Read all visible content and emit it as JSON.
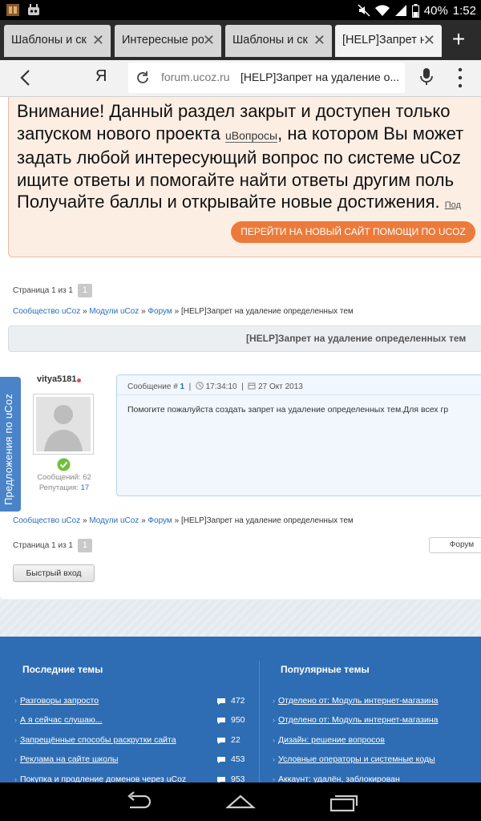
{
  "status_bar": {
    "battery_percent": "40%",
    "time": "1:52",
    "icons": [
      "app-icon",
      "robot-icon",
      "mute-icon",
      "wifi-icon",
      "signal-icon",
      "battery-icon"
    ]
  },
  "tabs": [
    {
      "label": "Шаблоны и ск",
      "active": false
    },
    {
      "label": "Интересные ро",
      "active": false
    },
    {
      "label": "Шаблоны и ск",
      "active": false
    },
    {
      "label": "[HELP]Запрет н",
      "active": true
    }
  ],
  "address_bar": {
    "yandex_label": "Я",
    "host": "forum.ucoz.ru",
    "page_title": "[HELP]Запрет на удаление о..."
  },
  "notice": {
    "line1": "Внимание! Данный раздел закрыт и доступен только",
    "line2_before": "запуском нового проекта ",
    "line2_link": "uВопросы",
    "line2_after": ", на котором Вы может",
    "line3": "задать любой интересующий вопрос по системе uCoz",
    "line4": "ищите ответы и помогайте найти ответы другим поль",
    "line5": "Получайте баллы и открывайте новые достижения.",
    "line5_link": "Под",
    "button": "ПЕРЕЙТИ НА НОВЫЙ САЙТ ПОМОЩИ ПО UCOZ"
  },
  "pager": {
    "label": "Страница 1 из 1",
    "page": "1"
  },
  "breadcrumbs": {
    "items": [
      "Сообщество uCoz",
      "Модули uCoz",
      "Форум"
    ],
    "sep": "»",
    "current": "[HELP]Запрет на удаление определенных тем"
  },
  "thread_title": "[HELP]Запрет на удаление определенных тем",
  "side_tab": "Предложения по uCoz",
  "post": {
    "username": "vitya5181",
    "messages_label": "Сообщений:",
    "messages": "62",
    "reputation_label": "Репутация:",
    "reputation": "17",
    "number_label": "Сообщение #",
    "number": "1",
    "time": "17:34:10",
    "date": "27 Окт 2013",
    "divider": "|",
    "body": "Помогите пожалуйста создать запрет на удаление определенных тем.Для всех гр"
  },
  "forum_button": "Форум",
  "quick_login": "Быстрый вход",
  "footer": {
    "latest_title": "Последние темы",
    "popular_title": "Популярные темы",
    "latest": [
      {
        "title": "Разговоры запросто",
        "count": "472"
      },
      {
        "title": "А я сейчас слушаю...",
        "count": "950"
      },
      {
        "title": "Запрещённые способы раскрутки сайта",
        "count": "22"
      },
      {
        "title": "Реклама на сайте школы",
        "count": "453"
      },
      {
        "title": "Покупка и продление доменов через uCoz",
        "count": "953"
      }
    ],
    "popular": [
      {
        "title": "Отделено от: Модуль интернет-магазина"
      },
      {
        "title": "Отделено от: Модуль интернет-магазина"
      },
      {
        "title": "Дизайн: решение вопросов"
      },
      {
        "title": "Условные операторы и системные коды"
      },
      {
        "title": "Аккаунт: удалён, заблокирован"
      }
    ]
  }
}
